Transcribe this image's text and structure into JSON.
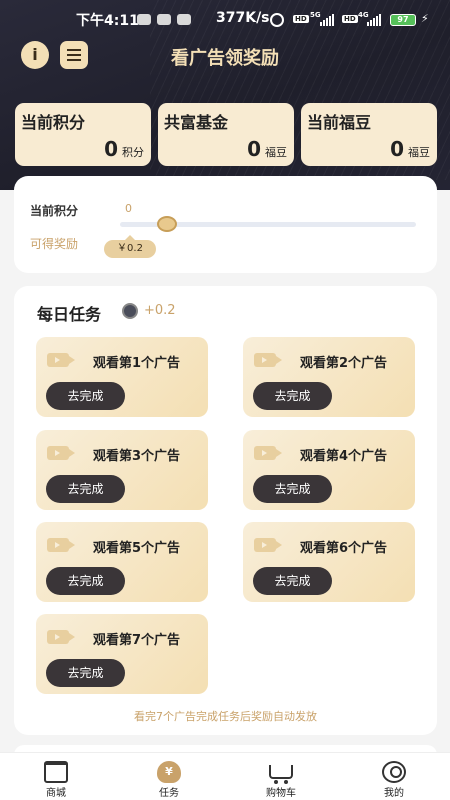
{
  "status_bar": {
    "time": "下午4:11",
    "net_speed": "377K/s",
    "hd_label": "HD",
    "net_5g": "5G",
    "net_4g": "4G",
    "battery": "97"
  },
  "header": {
    "title": "看广告领奖励"
  },
  "stats": [
    {
      "label": "当前积分",
      "value": "0",
      "unit": "积分"
    },
    {
      "label": "共富基金",
      "value": "0",
      "unit": "福豆"
    },
    {
      "label": "当前福豆",
      "value": "0",
      "unit": "福豆"
    }
  ],
  "progress": {
    "label": "当前积分",
    "current": "0",
    "reward_label": "可得奖励",
    "reward_value": "￥0.2",
    "level_fraction": 0.1
  },
  "daily_tasks": {
    "title": "每日任务",
    "bonus": "+0.2",
    "button_label": "去完成",
    "items": [
      {
        "label": "观看第1个广告"
      },
      {
        "label": "观看第2个广告"
      },
      {
        "label": "观看第3个广告"
      },
      {
        "label": "观看第4个广告"
      },
      {
        "label": "观看第5个广告"
      },
      {
        "label": "观看第6个广告"
      },
      {
        "label": "观看第7个广告"
      }
    ],
    "footer": "看完7个广告完成任务后奖励自动发放"
  },
  "tabbar": [
    {
      "label": "商城",
      "icon": "store-icon"
    },
    {
      "label": "任务",
      "icon": "money-bag-icon",
      "active": true
    },
    {
      "label": "购物车",
      "icon": "cart-icon"
    },
    {
      "label": "我的",
      "icon": "user-icon"
    }
  ],
  "colors": {
    "accent": "#c9a26a",
    "card_bg": "#f8ebd2",
    "header_bg": "#242433",
    "button_dark": "#3a3538"
  }
}
